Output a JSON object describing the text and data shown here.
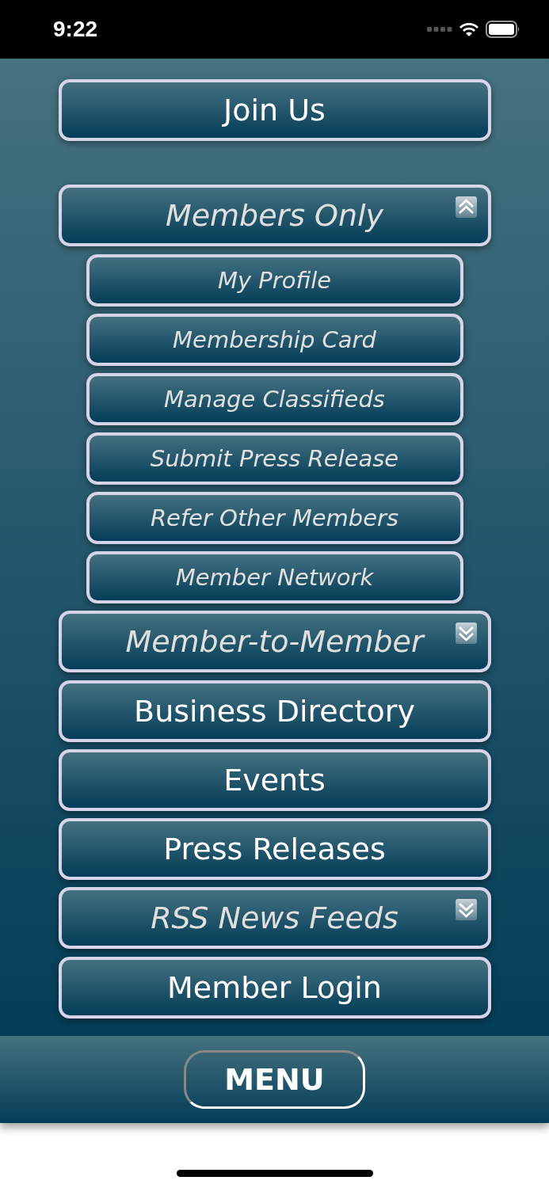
{
  "status_bar": {
    "time": "9:22"
  },
  "join_button": {
    "label": "Join Us"
  },
  "menu": [
    {
      "kind": "group",
      "label": "Members Only",
      "expanded": true,
      "children": [
        {
          "label": "My Profile"
        },
        {
          "label": "Membership Card"
        },
        {
          "label": "Manage Classifieds"
        },
        {
          "label": "Submit Press Release"
        },
        {
          "label": "Refer Other Members"
        },
        {
          "label": "Member Network"
        }
      ]
    },
    {
      "kind": "group",
      "label": "Member-to-Member",
      "expanded": false
    },
    {
      "kind": "link",
      "label": "Business Directory"
    },
    {
      "kind": "link",
      "label": "Events"
    },
    {
      "kind": "link",
      "label": "Press Releases"
    },
    {
      "kind": "group",
      "label": "RSS News Feeds",
      "expanded": false
    },
    {
      "kind": "link",
      "label": "Member Login"
    }
  ],
  "bottom_bar": {
    "menu_button": "MENU"
  }
}
